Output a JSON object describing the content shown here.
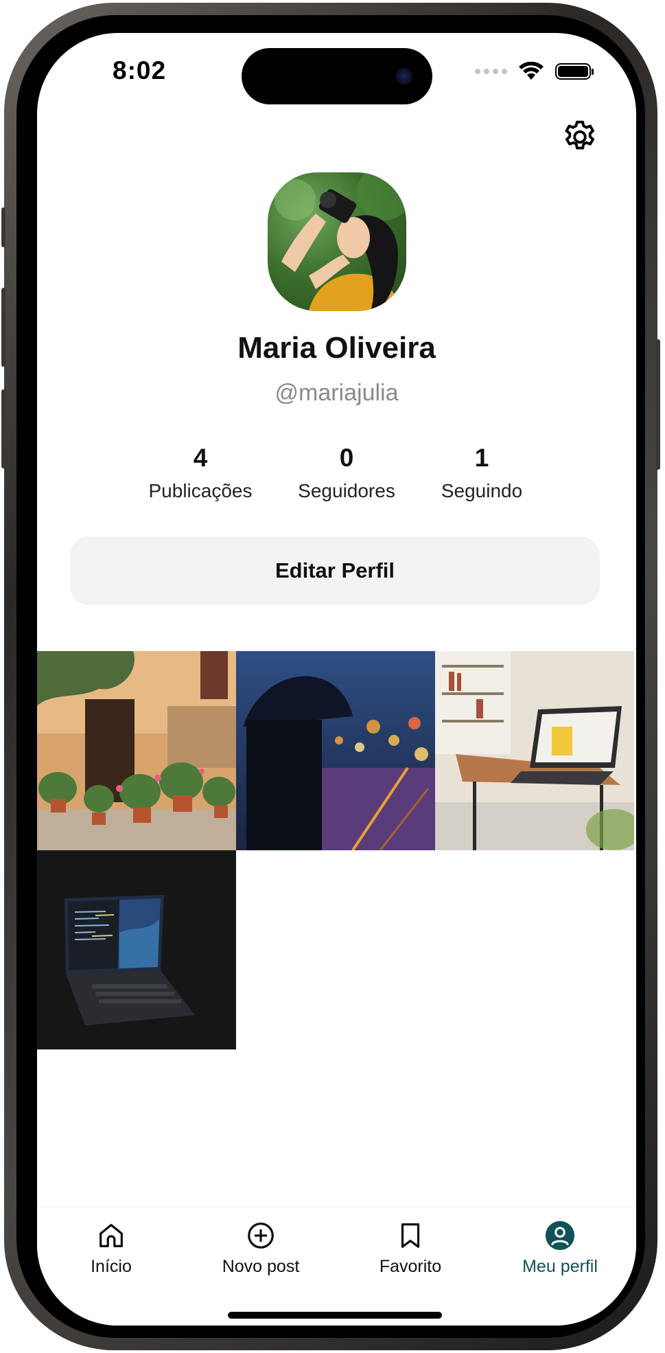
{
  "status_bar": {
    "time": "8:02"
  },
  "profile": {
    "name": "Maria Oliveira",
    "handle": "@mariajulia",
    "avatar_icon": "photographer-avatar"
  },
  "stats": [
    {
      "value": "4",
      "label": "Publicações"
    },
    {
      "value": "0",
      "label": "Seguidores"
    },
    {
      "value": "1",
      "label": "Seguindo"
    }
  ],
  "edit_button": {
    "label": "Editar Perfil"
  },
  "posts": [
    {
      "subject": "street with potted plants"
    },
    {
      "subject": "umbrella in rainy city night"
    },
    {
      "subject": "laptop on coffee table"
    },
    {
      "subject": "laptop with code on dark background"
    }
  ],
  "tab_bar": {
    "active_color": "#0f5257",
    "items": [
      {
        "label": "Início",
        "icon": "home-icon"
      },
      {
        "label": "Novo post",
        "icon": "plus-circle-icon"
      },
      {
        "label": "Favorito",
        "icon": "bookmark-icon"
      },
      {
        "label": "Meu perfil",
        "icon": "user-circle-icon",
        "active": true
      }
    ]
  }
}
